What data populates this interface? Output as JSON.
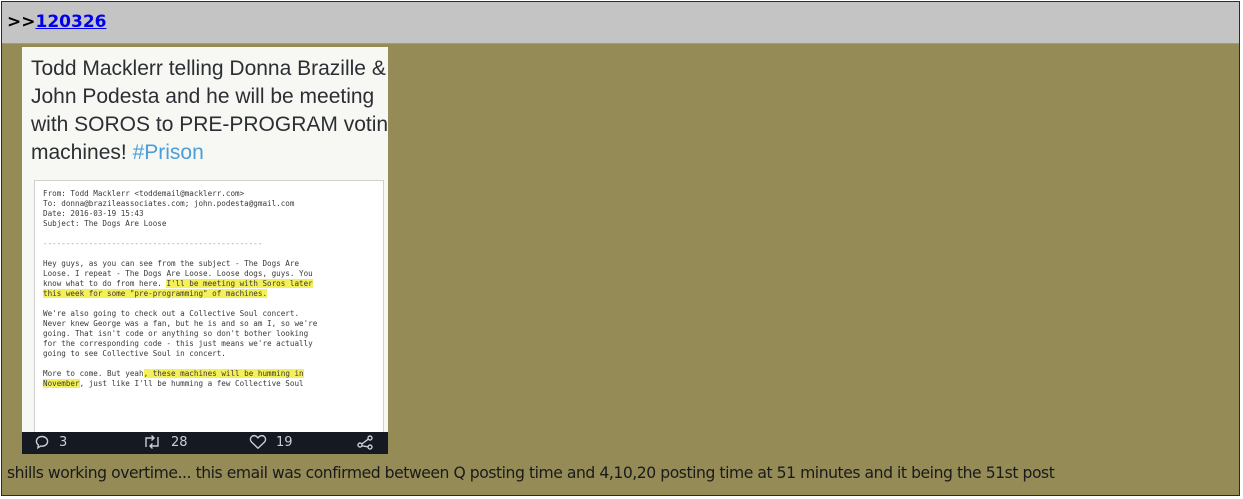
{
  "post": {
    "reply_prefix": ">>",
    "reply_ref": "120326",
    "comment": "shills working overtime... this email was confirmed between Q posting time and 4,10,20 posting time at 51 minutes and it being the 51st post"
  },
  "image": {
    "tweet_lines": [
      "Todd Macklerr telling Donna Brazille &",
      "John Podesta and he will be meeting",
      "with SOROS to PRE-PROGRAM voting"
    ],
    "tweet_last_line": "machines!",
    "hashtag": "#Prison",
    "email": {
      "from": "From: Todd Macklerr <toddemail@macklerr.com>",
      "to": "To: donna@brazileassociates.com; john.podesta@gmail.com",
      "date": "Date: 2016-03-19 15:43",
      "subject": "Subject: The Dogs Are Loose",
      "separator": "------------------------------------------------",
      "p1_l1": "Hey guys, as you can see from the subject - The Dogs Are",
      "p1_l2": "Loose. I repeat - The Dogs Are Loose. Loose dogs, guys. You",
      "p1_l3a": "know what to do from here. ",
      "p1_l3b": "I'll be meeting with Soros later",
      "p1_l4": "this week for some \"pre-programming\" of machines.",
      "p2_l1": "We're also going to check out a Collective Soul concert.",
      "p2_l2": "Never knew George was a fan, but he is and so am I, so we're",
      "p2_l3": "going. That isn't code or anything so don't bother looking",
      "p2_l4": "for the corresponding code - this just means we're actually",
      "p2_l5": "going to see Collective Soul in concert.",
      "p3_l1a": "More to come. But yeah",
      "p3_l1b": ", these machines will be humming in",
      "p3_l2a": "November",
      "p3_l2b": ", just like I'll be humming a few Collective Soul"
    },
    "actions": {
      "replies": "3",
      "retweets": "28",
      "likes": "19"
    },
    "colors": {
      "post_background": "#948b56",
      "header_background": "#c4c4c4",
      "link": "#0000ee",
      "highlight": "#f4f057",
      "hashtag": "#4a9fd9"
    }
  }
}
